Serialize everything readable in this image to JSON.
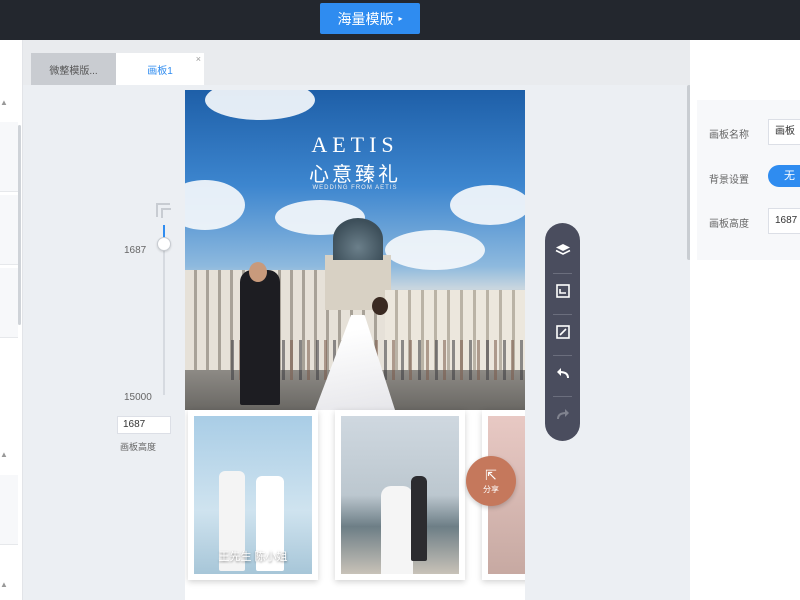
{
  "topbar": {
    "template_button": "海量模版",
    "template_caret": "▸"
  },
  "tabs": [
    {
      "label": "微整模版...",
      "active": false
    },
    {
      "label": "画板1",
      "active": true,
      "close": "×"
    }
  ],
  "slider": {
    "value": "1687",
    "max": "15000",
    "fill_fraction": 0.11
  },
  "height_field": {
    "value": "1687",
    "label": "画板高度"
  },
  "canvas": {
    "brand": "AETIS",
    "tagline_cn": "心意臻礼",
    "subtitle": "WEDDING FROM AETIS",
    "card1_caption": "王先生 陈小姐"
  },
  "share": {
    "label": "分享",
    "icon": "share-icon"
  },
  "toolbar": {
    "icons": [
      "layers-icon",
      "preview-icon",
      "edit-icon",
      "undo-icon",
      "redo-icon"
    ]
  },
  "properties": {
    "name_label": "画板名称",
    "name_value": "画板",
    "bg_label": "背景设置",
    "bg_value": "无",
    "height_label": "画板高度",
    "height_value": "1687"
  },
  "colors": {
    "accent": "#2f8cf0",
    "topbar": "#23272e",
    "toolbar": "#4a4d5e",
    "share": "#c5785c"
  }
}
